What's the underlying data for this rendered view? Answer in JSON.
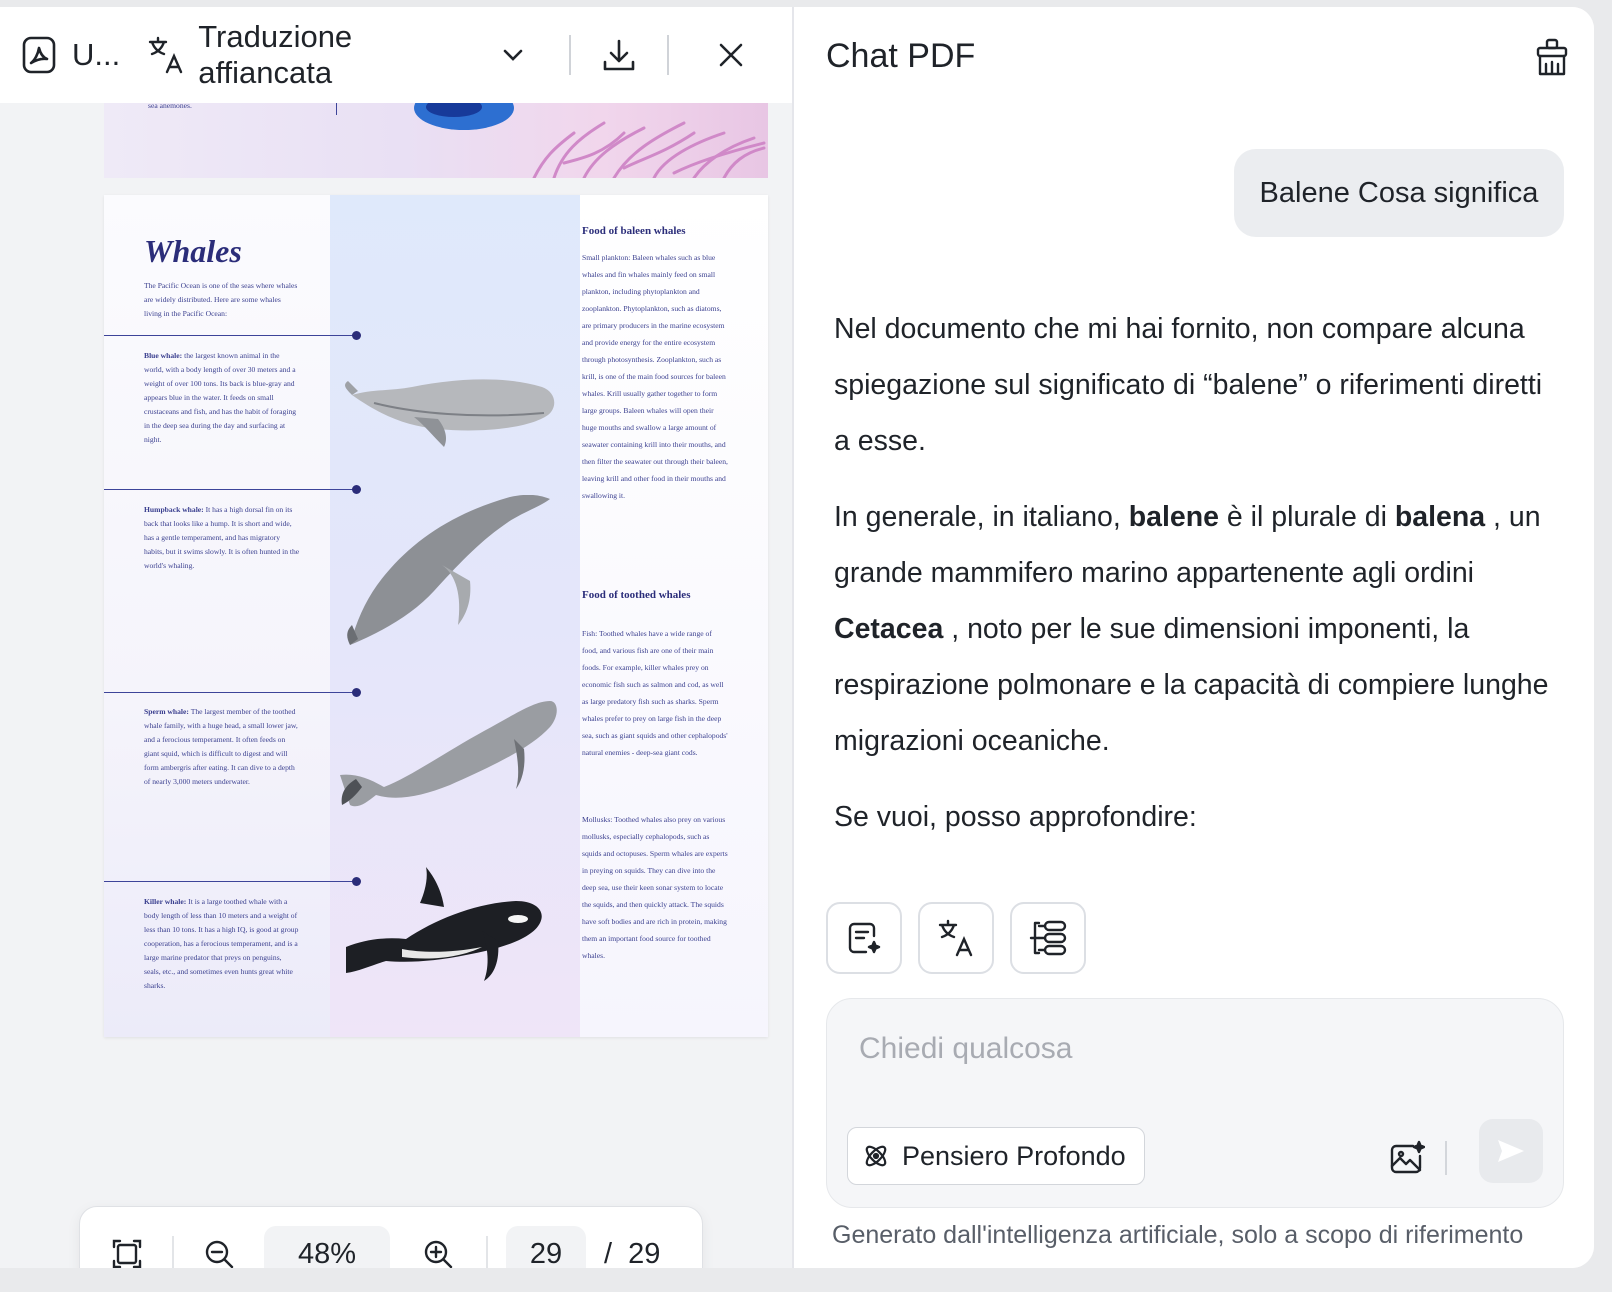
{
  "toolbar": {
    "doc_title": "U...",
    "translate_mode": "Traduzione affiancata"
  },
  "pdf": {
    "prev_page_text": "sea anemones.",
    "title": "Whales",
    "intro": "The Pacific Ocean is one of the seas where whales are widely distributed. Here are some whales living in the Pacific Ocean:",
    "entries": [
      {
        "name": "Blue whale:",
        "text": " the largest known animal in the world, with a body length of over 30 meters and a weight of over 100 tons. Its back is blue-gray and appears blue in the water. It feeds on small crustaceans and fish, and has the habit of foraging in the deep sea during the day and surfacing at night."
      },
      {
        "name": "Humpback whale:",
        "text": " It has a high dorsal fin on its back that looks like a hump. It is short and wide, has a gentle temperament, and has migratory habits, but it swims slowly. It is often hunted in the world's whaling."
      },
      {
        "name": "Sperm whale:",
        "text": " The largest member of the toothed whale family, with a huge head, a small lower jaw, and a ferocious temperament. It often feeds on giant squid, which is difficult to digest and will form ambergris after eating. It can dive to a depth of nearly 3,000 meters underwater."
      },
      {
        "name": "Killer whale:",
        "text": " It is a large toothed whale with a body length of less than 10 meters and a weight of less than 10 tons. It has a high IQ, is good at group cooperation, has a ferocious temperament, and is a large marine predator that preys on penguins, seals, etc., and sometimes even hunts great white sharks."
      }
    ],
    "baleen_head": "Food of baleen whales",
    "baleen_text": "Small plankton: Baleen whales such as blue whales and fin whales mainly feed on small plankton, including phytoplankton and zooplankton. Phytoplankton, such as diatoms, are primary producers in the marine ecosystem and provide energy for the entire ecosystem through photosynthesis. Zooplankton, such as krill, is one of the main food sources for baleen whales. Krill usually gather together to form large groups. Baleen whales will open their huge mouths and swallow a large amount of seawater containing krill into their mouths, and then filter the seawater out through their baleen, leaving krill and other food in their mouths and swallowing it.",
    "toothed_head": "Food of toothed whales",
    "toothed_text": "Fish: Toothed whales have a wide range of food, and various fish are one of their main foods. For example, killer whales prey on economic fish such as salmon and cod, as well as large predatory fish such as sharks. Sperm whales prefer to prey on large fish in the deep sea, such as giant squids and other cephalopods' natural enemies - deep-sea giant cods.",
    "mollusks_text": "Mollusks: Toothed whales also prey on various mollusks, especially cephalopods, such as squids and octopuses. Sperm whales are experts in preying on squids. They can dive into the deep sea, use their keen sonar system to locate the squids, and then quickly attack. The squids have soft bodies and are rich in protein, making them an important food source for toothed whales."
  },
  "zoom": {
    "level": "48%",
    "current_page": "29",
    "separator": "/",
    "total_pages": "29"
  },
  "chat": {
    "title": "Chat PDF",
    "user_message": "Balene Cosa significa",
    "answer": {
      "p1": "Nel documento che mi hai fornito, non compare alcuna spiegazione sul significato di “balene” o riferimenti diretti a esse.",
      "p2_a": "In generale, in italiano, ",
      "p2_b1": "balene",
      "p2_c": " è il plurale di ",
      "p2_b2": "balena",
      "p2_d": " , un grande mammifero marino appartenente agli ordini ",
      "p2_b3": "Cetacea",
      "p2_e": " , noto per le sue dimensioni imponenti, la respirazione polmonare e la capacità di compiere lunghe migrazioni oceaniche.",
      "p3": "Se vuoi, posso approfondire:"
    },
    "input_placeholder": "Chiedi qualcosa",
    "deep_think_label": "Pensiero Profondo",
    "disclaimer": "Generato dall'intelligenza artificiale, solo a scopo di riferimento"
  },
  "colors": {
    "accent_text": "#1f2329",
    "pdf_ink": "#2b2d7a",
    "panel_bg": "#f2f3f5"
  }
}
